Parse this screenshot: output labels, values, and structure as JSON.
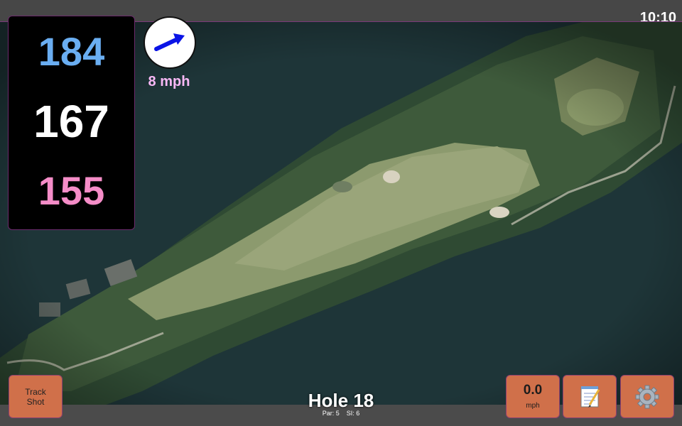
{
  "status": {
    "time": "10:10"
  },
  "distances": {
    "back": "184",
    "middle": "167",
    "front": "155"
  },
  "wind": {
    "speed_label": "8 mph",
    "icon": "wind-direction-arrow-icon"
  },
  "hole": {
    "title": "Hole 18",
    "par_label": "Par: 5",
    "si_label": "SI: 6"
  },
  "buttons": {
    "track_line1": "Track",
    "track_line2": "Shot",
    "speed_value": "0.0",
    "speed_unit": "mph",
    "notes_icon": "notepad-icon",
    "settings_icon": "gear-icon"
  },
  "colors": {
    "back_distance": "#6aaef2",
    "middle_distance": "#ffffff",
    "front_distance": "#f58dc8",
    "wind_label": "#f9b8f6",
    "button": "#d0704a",
    "wind_arrow": "#0a14e6"
  }
}
